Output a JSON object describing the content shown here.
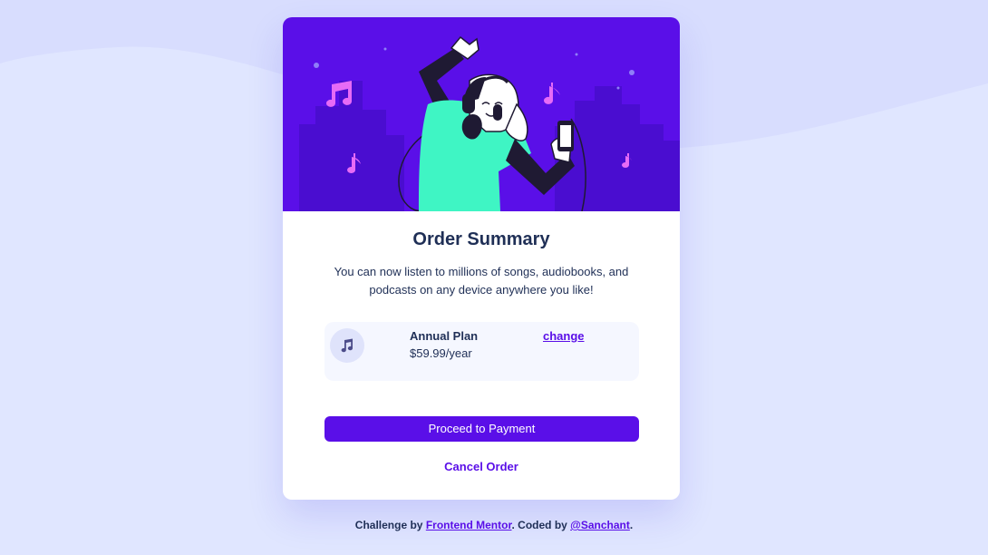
{
  "card": {
    "title": "Order Summary",
    "description": "You can now listen to millions of songs, audiobooks, and podcasts on any device anywhere you like!",
    "plan": {
      "icon": "music-note-icon",
      "name": "Annual Plan",
      "price": "$59.99/year",
      "change_label": "change"
    },
    "proceed_label": "Proceed to Payment",
    "cancel_label": "Cancel Order"
  },
  "footer": {
    "prefix": "Challenge by ",
    "link1": "Frontend Mentor",
    "middle": ". Coded by ",
    "link2": "@Sanchant",
    "suffix": "."
  },
  "colors": {
    "page_background": "#e0e6ff",
    "hero_background": "#5a0fe8",
    "accent": "#5a0fe8",
    "text": "#1f2f56",
    "plan_box": "#f5f7ff"
  }
}
